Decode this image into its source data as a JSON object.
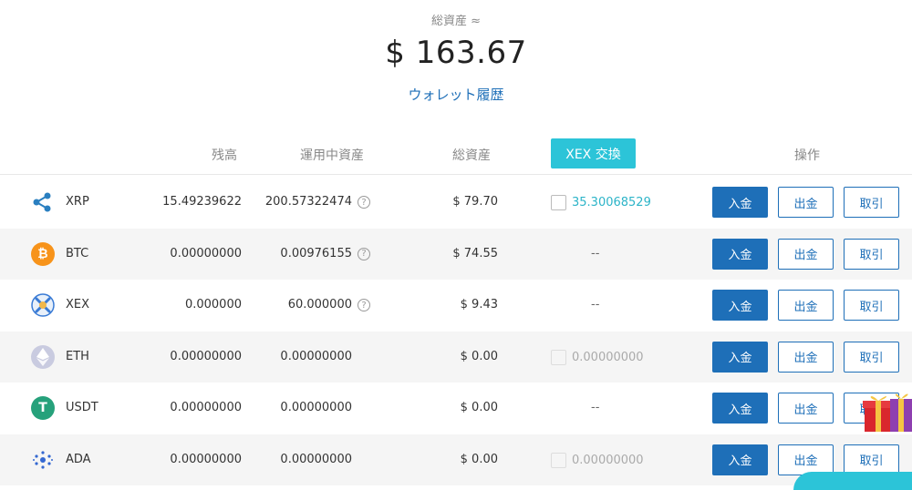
{
  "summary": {
    "label": "総資産 ≈",
    "value": "$ 163.67",
    "history_link": "ウォレット履歴"
  },
  "header": {
    "balance": "残高",
    "staking": "運用中資産",
    "total": "総資産",
    "xex_exchange": "XEX 交換",
    "action": "操作"
  },
  "buttons": {
    "deposit": "入金",
    "withdraw": "出金",
    "trade": "取引"
  },
  "rows": [
    {
      "coin": "XRP",
      "balance": "15.49239622",
      "staking": "200.57322474",
      "staking_help": "?",
      "total": "$ 79.70",
      "exchange": "35.30068529",
      "dash": ""
    },
    {
      "coin": "BTC",
      "balance": "0.00000000",
      "staking": "0.00976155",
      "staking_help": "?",
      "total": "$ 74.55",
      "exchange": "",
      "dash": "--"
    },
    {
      "coin": "XEX",
      "balance": "0.000000",
      "staking": "60.000000",
      "staking_help": "?",
      "total": "$ 9.43",
      "exchange": "",
      "dash": "--"
    },
    {
      "coin": "ETH",
      "balance": "0.00000000",
      "staking": "0.00000000",
      "total": "$ 0.00",
      "exchange": "0.00000000",
      "dash": ""
    },
    {
      "coin": "USDT",
      "balance": "0.00000000",
      "staking": "0.00000000",
      "total": "$ 0.00",
      "exchange": "",
      "dash": "--"
    },
    {
      "coin": "ADA",
      "balance": "0.00000000",
      "staking": "0.00000000",
      "total": "$ 0.00",
      "exchange": "0.00000000",
      "dash": ""
    }
  ],
  "icons": {
    "xrp": "xrp-icon",
    "btc": "btc-icon",
    "xex": "xex-icon",
    "eth": "eth-icon",
    "usdt": "usdt-icon",
    "ada": "ada-icon"
  },
  "colors": {
    "primary": "#1e6fb8",
    "accent": "#2cc4d8",
    "btc": "#f7931a",
    "usdt": "#26a17b"
  }
}
